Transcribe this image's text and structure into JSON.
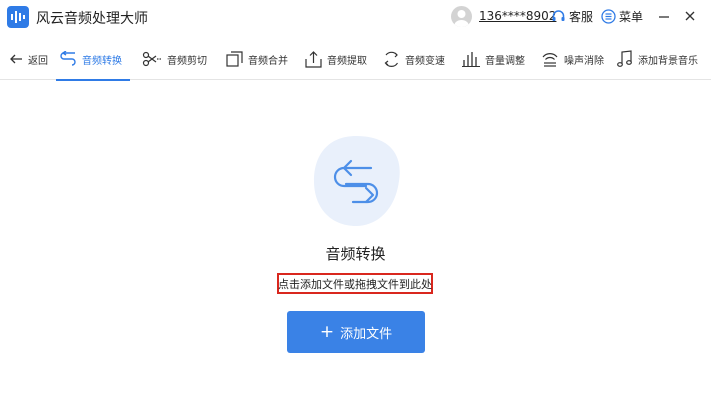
{
  "titlebar": {
    "app_title": "风云音频处理大师",
    "phone": "136****8902",
    "service_label": "客服",
    "menu_label": "菜单",
    "minimize_glyph": "—",
    "close_glyph": "✕"
  },
  "toolbar": {
    "back_label": "返回",
    "items": [
      {
        "label": "音频转换",
        "icon": "convert-icon",
        "active": true
      },
      {
        "label": "音频剪切",
        "icon": "scissors-icon"
      },
      {
        "label": "音频合并",
        "icon": "merge-icon"
      },
      {
        "label": "音频提取",
        "icon": "extract-icon"
      },
      {
        "label": "音频变速",
        "icon": "speed-icon"
      },
      {
        "label": "音量调整",
        "icon": "volume-bars-icon"
      },
      {
        "label": "噪声消除",
        "icon": "noise-icon"
      },
      {
        "label": "添加背景音乐",
        "icon": "music-note-icon"
      }
    ]
  },
  "main": {
    "title": "音频转换",
    "hint": "点击添加文件或拖拽文件到此处",
    "add_button_label": "添加文件",
    "add_button_glyph": "+"
  },
  "colors": {
    "accent": "#2f7be6",
    "button": "#3a82e6",
    "hint_border": "#d9271e",
    "hero_bg": "#e9f0fb"
  }
}
